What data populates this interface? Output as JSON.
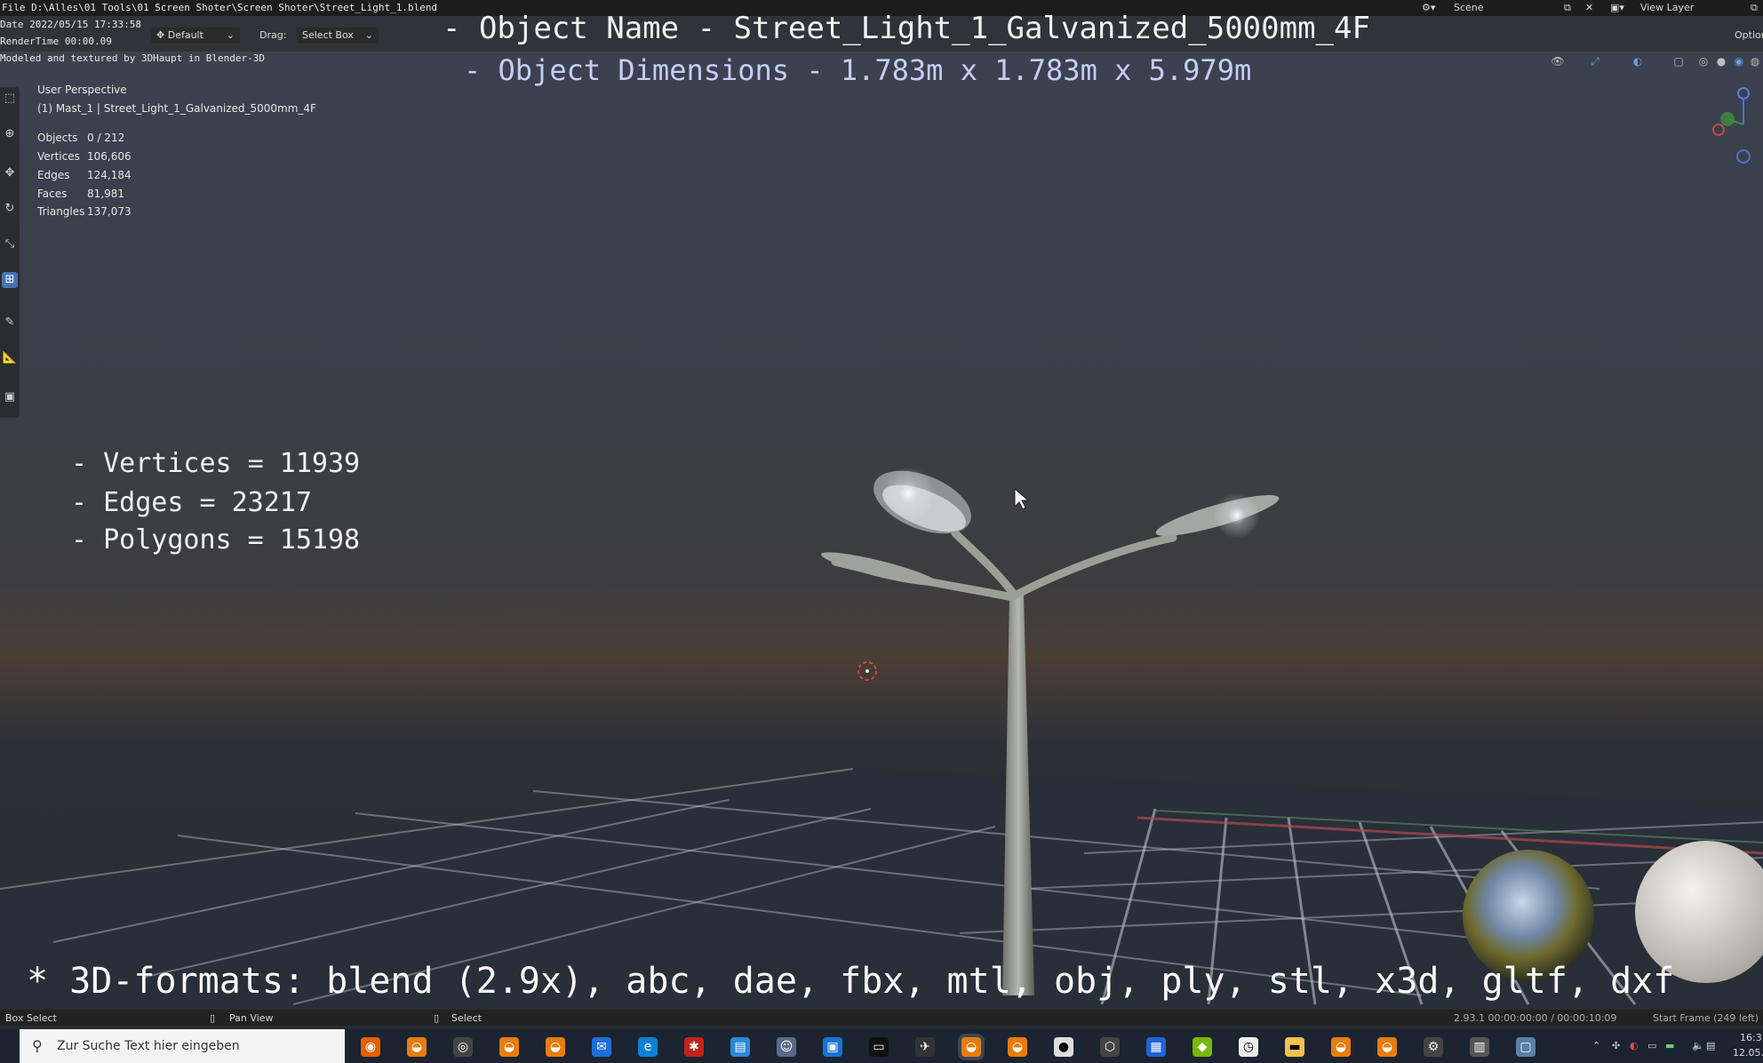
{
  "title_bar": {
    "file_path": "File D:\\Alles\\01 Tools\\01 Screen Shoter\\Screen Shoter\\Street_Light_1.blend",
    "scene_label": "Scene",
    "view_layer_label": "View Layer"
  },
  "info_overlay": {
    "date": "Date 2022/05/15 17:33:58",
    "render_time": "RenderTime 00:00.09",
    "credit": "Modeled and textured by 3DHaupt in Blender-3D"
  },
  "header": {
    "orientation_value": "Default",
    "drag_label": "Drag:",
    "drag_value": "Select Box",
    "options_label": "Option"
  },
  "viewport": {
    "perspective": "User Perspective",
    "active_object": "(1) Mast_1 | Street_Light_1_Galvanized_5000mm_4F",
    "stats": [
      {
        "label": "Objects",
        "value": "0 / 212"
      },
      {
        "label": "Vertices",
        "value": "106,606"
      },
      {
        "label": "Edges",
        "value": "124,184"
      },
      {
        "label": "Faces",
        "value": "81,981"
      },
      {
        "label": "Triangles",
        "value": "137,073"
      }
    ]
  },
  "overlay": {
    "object_name": "- Object Name - Street_Light_1_Galvanized_5000mm_4F",
    "object_dimensions": "- Object Dimensions -  1.783m x 1.783m x 5.979m",
    "vertices": "- Vertices = 11939",
    "edges": "- Edges = 23217",
    "polygons": "- Polygons = 15198",
    "formats": "* 3D-formats: blend (2.9x), abc, dae, fbx, mtl, obj, ply, stl, x3d, gltf, dxf"
  },
  "status_bar": {
    "box_select": "Box Select",
    "pan_view": "Pan View",
    "select": "Select",
    "version_time": "2.93.1  00:00:00:00 / 00:00:10:09",
    "start_frame": "Start Frame (249 left)"
  },
  "taskbar": {
    "search_placeholder": "Zur Suche Text hier eingeben",
    "clock_time": "16:3",
    "clock_date": "12.05."
  },
  "colors": {
    "accent_blue": "#4772b3",
    "overlay_dim_color": "#c6cdf5"
  }
}
